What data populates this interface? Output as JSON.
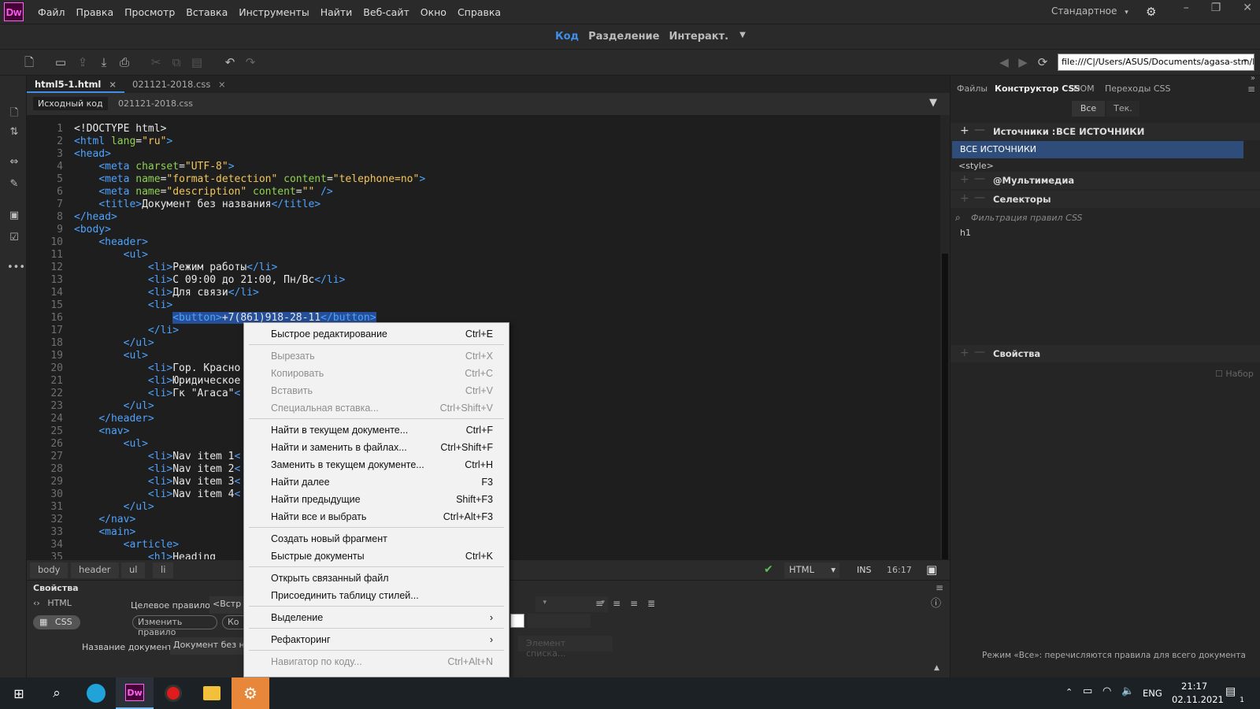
{
  "app": {
    "logo": "Dw"
  },
  "menubar": {
    "items": [
      "Файл",
      "Правка",
      "Просмотр",
      "Вставка",
      "Инструменты",
      "Найти",
      "Веб-сайт",
      "Окно",
      "Справка"
    ],
    "workspace": "Стандартное"
  },
  "viewbar": {
    "code": "Код",
    "split": "Разделение",
    "live": "Интеракт."
  },
  "toolbar": {
    "url": "file:///C|/Users/ASUS/Documents/agasa-stm/h"
  },
  "doc_tabs": [
    "html5-1.html",
    "021121-2018.css"
  ],
  "sub_tabs": [
    "Исходный код",
    "021121-2018.css"
  ],
  "code_lines": [
    {
      "n": "1",
      "parts": [
        [
          "tx",
          "<!DOCTYPE html>"
        ]
      ]
    },
    {
      "n": "2",
      "parts": [
        [
          "tg",
          "<html "
        ],
        [
          "at",
          "lang"
        ],
        [
          "tx",
          "="
        ],
        [
          "vl",
          "\"ru\""
        ],
        [
          "tg",
          ">"
        ]
      ]
    },
    {
      "n": "3",
      "parts": [
        [
          "tg",
          "<head>"
        ]
      ]
    },
    {
      "n": "4",
      "parts": [
        [
          "tx",
          "    "
        ],
        [
          "tg",
          "<meta "
        ],
        [
          "at",
          "charset"
        ],
        [
          "tx",
          "="
        ],
        [
          "vl",
          "\"UTF-8\""
        ],
        [
          "tg",
          ">"
        ]
      ]
    },
    {
      "n": "5",
      "parts": [
        [
          "tx",
          "    "
        ],
        [
          "tg",
          "<meta "
        ],
        [
          "at",
          "name"
        ],
        [
          "tx",
          "="
        ],
        [
          "vl",
          "\"format-detection\""
        ],
        [
          "at",
          " content"
        ],
        [
          "tx",
          "="
        ],
        [
          "vl",
          "\"telephone=no\""
        ],
        [
          "tg",
          ">"
        ]
      ]
    },
    {
      "n": "6",
      "parts": [
        [
          "tx",
          "    "
        ],
        [
          "tg",
          "<meta "
        ],
        [
          "at",
          "name"
        ],
        [
          "tx",
          "="
        ],
        [
          "vl",
          "\"description\""
        ],
        [
          "at",
          " content"
        ],
        [
          "tx",
          "="
        ],
        [
          "vl",
          "\"\""
        ],
        [
          "tg",
          " />"
        ]
      ]
    },
    {
      "n": "7",
      "parts": [
        [
          "tx",
          "    "
        ],
        [
          "tg",
          "<title>"
        ],
        [
          "tx",
          "Документ без названия"
        ],
        [
          "tg",
          "</title>"
        ]
      ]
    },
    {
      "n": "8",
      "parts": [
        [
          "tg",
          "</head>"
        ]
      ]
    },
    {
      "n": "9",
      "parts": [
        [
          "tg",
          "<body>"
        ]
      ]
    },
    {
      "n": "10",
      "parts": [
        [
          "tx",
          "    "
        ],
        [
          "tg",
          "<header>"
        ]
      ]
    },
    {
      "n": "11",
      "parts": [
        [
          "tx",
          "        "
        ],
        [
          "tg",
          "<ul>"
        ]
      ]
    },
    {
      "n": "12",
      "parts": [
        [
          "tx",
          "            "
        ],
        [
          "tg",
          "<li>"
        ],
        [
          "tx",
          "Режим работы"
        ],
        [
          "tg",
          "</li>"
        ]
      ]
    },
    {
      "n": "13",
      "parts": [
        [
          "tx",
          "            "
        ],
        [
          "tg",
          "<li>"
        ],
        [
          "tx",
          "С 09:00 до 21:00, Пн/Вс"
        ],
        [
          "tg",
          "</li>"
        ]
      ]
    },
    {
      "n": "14",
      "parts": [
        [
          "tx",
          "            "
        ],
        [
          "tg",
          "<li>"
        ],
        [
          "tx",
          "Для связи"
        ],
        [
          "tg",
          "</li>"
        ]
      ]
    },
    {
      "n": "15",
      "parts": [
        [
          "tx",
          "            "
        ],
        [
          "tg",
          "<li>"
        ]
      ]
    },
    {
      "n": "16",
      "parts": [
        [
          "tx",
          "                "
        ],
        [
          "tgsel",
          "<button>"
        ],
        [
          "txsel",
          "+7(861)918-28-11"
        ],
        [
          "tgsel",
          "</button>"
        ]
      ]
    },
    {
      "n": "17",
      "parts": [
        [
          "tx",
          "            "
        ],
        [
          "tg",
          "</li>"
        ]
      ]
    },
    {
      "n": "18",
      "parts": [
        [
          "tx",
          "        "
        ],
        [
          "tg",
          "</ul>"
        ]
      ]
    },
    {
      "n": "19",
      "parts": [
        [
          "tx",
          "        "
        ],
        [
          "tg",
          "<ul>"
        ]
      ]
    },
    {
      "n": "20",
      "parts": [
        [
          "tx",
          "            "
        ],
        [
          "tg",
          "<li>"
        ],
        [
          "tx",
          "Гор. Красно"
        ]
      ]
    },
    {
      "n": "21",
      "parts": [
        [
          "tx",
          "            "
        ],
        [
          "tg",
          "<li>"
        ],
        [
          "tx",
          "Юридическое"
        ]
      ]
    },
    {
      "n": "22",
      "parts": [
        [
          "tx",
          "            "
        ],
        [
          "tg",
          "<li>"
        ],
        [
          "tx",
          "Гк \"Агаса\""
        ],
        [
          "tg",
          "<"
        ]
      ]
    },
    {
      "n": "23",
      "parts": [
        [
          "tx",
          "        "
        ],
        [
          "tg",
          "</ul>"
        ]
      ]
    },
    {
      "n": "24",
      "parts": [
        [
          "tx",
          "    "
        ],
        [
          "tg",
          "</header>"
        ]
      ]
    },
    {
      "n": "25",
      "parts": [
        [
          "tx",
          "    "
        ],
        [
          "tg",
          "<nav>"
        ]
      ]
    },
    {
      "n": "26",
      "parts": [
        [
          "tx",
          "        "
        ],
        [
          "tg",
          "<ul>"
        ]
      ]
    },
    {
      "n": "27",
      "parts": [
        [
          "tx",
          "            "
        ],
        [
          "tg",
          "<li>"
        ],
        [
          "tx",
          "Nav item 1"
        ],
        [
          "tg",
          "<"
        ]
      ]
    },
    {
      "n": "28",
      "parts": [
        [
          "tx",
          "            "
        ],
        [
          "tg",
          "<li>"
        ],
        [
          "tx",
          "Nav item 2"
        ],
        [
          "tg",
          "<"
        ]
      ]
    },
    {
      "n": "29",
      "parts": [
        [
          "tx",
          "            "
        ],
        [
          "tg",
          "<li>"
        ],
        [
          "tx",
          "Nav item 3"
        ],
        [
          "tg",
          "<"
        ]
      ]
    },
    {
      "n": "30",
      "parts": [
        [
          "tx",
          "            "
        ],
        [
          "tg",
          "<li>"
        ],
        [
          "tx",
          "Nav item 4"
        ],
        [
          "tg",
          "<"
        ]
      ]
    },
    {
      "n": "31",
      "parts": [
        [
          "tx",
          "        "
        ],
        [
          "tg",
          "</ul>"
        ]
      ]
    },
    {
      "n": "32",
      "parts": [
        [
          "tx",
          "    "
        ],
        [
          "tg",
          "</nav>"
        ]
      ]
    },
    {
      "n": "33",
      "parts": [
        [
          "tx",
          "    "
        ],
        [
          "tg",
          "<main>"
        ]
      ]
    },
    {
      "n": "34",
      "parts": [
        [
          "tx",
          "        "
        ],
        [
          "tg",
          "<article>"
        ]
      ]
    },
    {
      "n": "35",
      "parts": [
        [
          "tx",
          "            "
        ],
        [
          "tg",
          "<h1>"
        ],
        [
          "tx",
          "Heading"
        ]
      ]
    }
  ],
  "status": {
    "crumbs": [
      "body",
      "header",
      "ul",
      "li"
    ],
    "language": "HTML",
    "mode": "INS",
    "position": "16:17"
  },
  "properties": {
    "title": "Свойства",
    "html_btn": "HTML",
    "css_btn": "CSS",
    "target_rule_label": "Целевое правило",
    "target_rule_value": "<Встр",
    "edit_rule_btn": "Изменить правило",
    "ko_btn": "Ко",
    "doc_title_label": "Название документа",
    "doc_title_value": "Документ без на",
    "list_item_btn": "Элемент списка..."
  },
  "right_panel": {
    "tabs": [
      "Файлы",
      "Конструктор CSS",
      "DOM",
      "Переходы CSS"
    ],
    "filter_all": "Все",
    "filter_current": "Тек.",
    "sources_label": "Источники :",
    "sources_value": "ВСЕ ИСТОЧНИКИ",
    "sources_item": "ВСЕ ИСТОЧНИКИ",
    "style_item": "<style>",
    "media_label": "@Мультимедиа",
    "selectors_label": "Селекторы",
    "filter_placeholder": "Фильтрация правил CSS",
    "selector_item": "h1",
    "properties_label": "Свойства",
    "set_label": "Набор",
    "footer": "Режим «Все»: перечисляются правила для всего документа"
  },
  "context_menu": [
    {
      "label": "Быстрое редактирование",
      "shortcut": "Ctrl+E",
      "disabled": false
    },
    {
      "sep": true
    },
    {
      "label": "Вырезать",
      "shortcut": "Ctrl+X",
      "disabled": true
    },
    {
      "label": "Копировать",
      "shortcut": "Ctrl+C",
      "disabled": true
    },
    {
      "label": "Вставить",
      "shortcut": "Ctrl+V",
      "disabled": true
    },
    {
      "label": "Специальная вставка...",
      "shortcut": "Ctrl+Shift+V",
      "disabled": true
    },
    {
      "sep": true
    },
    {
      "label": "Найти в текущем документе...",
      "shortcut": "Ctrl+F",
      "disabled": false
    },
    {
      "label": "Найти и заменить в файлах...",
      "shortcut": "Ctrl+Shift+F",
      "disabled": false
    },
    {
      "label": "Заменить в текущем документе...",
      "shortcut": "Ctrl+H",
      "disabled": false
    },
    {
      "label": "Найти далее",
      "shortcut": "F3",
      "disabled": false
    },
    {
      "label": "Найти предыдущие",
      "shortcut": "Shift+F3",
      "disabled": false
    },
    {
      "label": "Найти все и выбрать",
      "shortcut": "Ctrl+Alt+F3",
      "disabled": false
    },
    {
      "sep": true
    },
    {
      "label": "Создать новый фрагмент",
      "shortcut": "",
      "disabled": false
    },
    {
      "label": "Быстрые документы",
      "shortcut": "Ctrl+K",
      "disabled": false
    },
    {
      "sep": true
    },
    {
      "label": "Открыть связанный файл",
      "shortcut": "",
      "disabled": false
    },
    {
      "label": "Присоединить таблицу стилей...",
      "shortcut": "",
      "disabled": false
    },
    {
      "sep": true
    },
    {
      "label": "Выделение",
      "shortcut": "›",
      "disabled": false
    },
    {
      "sep": true
    },
    {
      "label": "Рефакторинг",
      "shortcut": "›",
      "disabled": false
    },
    {
      "sep": true
    },
    {
      "label": "Навигатор по коду...",
      "shortcut": "Ctrl+Alt+N",
      "disabled": true
    }
  ],
  "taskbar": {
    "lang": "ENG",
    "time": "21:17",
    "date": "02.11.2021",
    "notif_count": "1",
    "dw_label": "Dw"
  },
  "colors": {
    "accent": "#3f8fe8",
    "selection": "#264f9a",
    "dw_bg": "#470137",
    "dw_fg": "#ff61f6"
  }
}
